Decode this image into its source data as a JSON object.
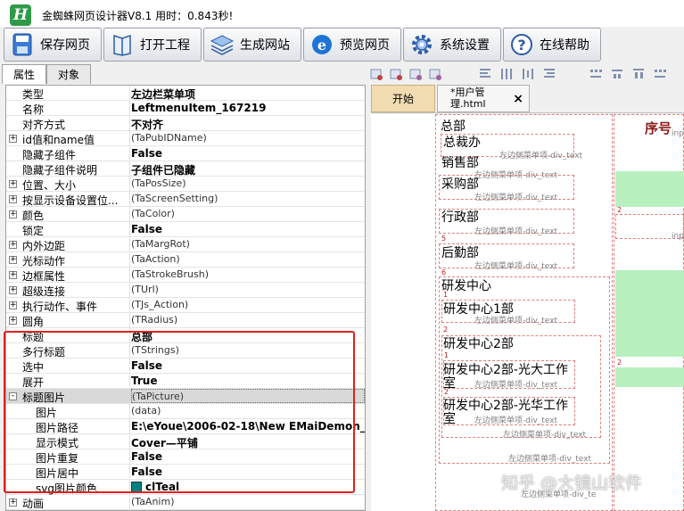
{
  "window": {
    "logo_letter": "H",
    "title": "金蜘蛛网页设计器V8.1 用时：0.843秒!"
  },
  "toolbar": [
    {
      "label": "保存网页",
      "icon": "save-icon"
    },
    {
      "label": "打开工程",
      "icon": "open-book-icon"
    },
    {
      "label": "生成网站",
      "icon": "layers-icon"
    },
    {
      "label": "预览网页",
      "icon": "ie-browser-icon"
    },
    {
      "label": "系统设置",
      "icon": "gear-icon"
    },
    {
      "label": "在线帮助",
      "icon": "help-icon"
    }
  ],
  "panel_tabs": {
    "properties": "属性",
    "objects": "对象"
  },
  "properties": [
    {
      "name": "类型",
      "value": "左边栏菜单项",
      "bold": true
    },
    {
      "name": "名称",
      "value": "LeftmenuItem_167219",
      "bold": true
    },
    {
      "name": "对齐方式",
      "value": "不对齐",
      "bold": true
    },
    {
      "name": "id值和name值",
      "value": "(TaPubIDName)",
      "expand": "+"
    },
    {
      "name": "隐藏子组件",
      "value": "False",
      "bold": true
    },
    {
      "name": "隐藏子组件说明",
      "value": "子组件已隐藏",
      "bold": true
    },
    {
      "name": "位置、大小",
      "value": "(TaPosSize)",
      "expand": "+"
    },
    {
      "name": "按显示设备设置位...",
      "value": "(TaScreenSetting)",
      "expand": "+"
    },
    {
      "name": "颜色",
      "value": "(TaColor)",
      "expand": "+"
    },
    {
      "name": "锁定",
      "value": "False",
      "bold": true
    },
    {
      "name": "内外边距",
      "value": "(TaMargRot)",
      "expand": "+"
    },
    {
      "name": "光标动作",
      "value": "(TaAction)",
      "expand": "+"
    },
    {
      "name": "边框属性",
      "value": "(TaStrokeBrush)",
      "expand": "+"
    },
    {
      "name": "超级连接",
      "value": "(TUrl)",
      "expand": "+"
    },
    {
      "name": "执行动作、事件",
      "value": "(TJs_Action)",
      "expand": "+"
    },
    {
      "name": "圆角",
      "value": "(TRadius)",
      "expand": "+"
    },
    {
      "name": "标题",
      "value": "总部",
      "bold": true
    },
    {
      "name": "多行标题",
      "value": "(TStrings)"
    },
    {
      "name": "选中",
      "value": "False",
      "bold": true
    },
    {
      "name": "展开",
      "value": "True",
      "bold": true
    },
    {
      "name": "标题图片",
      "value": "(TaPicture)",
      "expand": "-",
      "selected": true
    },
    {
      "name": "图片",
      "value": "(data)",
      "indent": true
    },
    {
      "name": "图片路径",
      "value": "E:\\eYoue\\2006-02-18\\New EMaiDemon_Chin...",
      "bold": true,
      "indent": true
    },
    {
      "name": "显示模式",
      "value": "Cover—平铺",
      "bold": true,
      "indent": true
    },
    {
      "name": "图片重复",
      "value": "False",
      "bold": true,
      "indent": true
    },
    {
      "name": "图片居中",
      "value": "False",
      "bold": true,
      "indent": true
    },
    {
      "name": "svg图片颜色",
      "value": "clTeal",
      "bold": true,
      "indent": true,
      "swatch": "#008080"
    },
    {
      "name": "动画",
      "value": "(TaAnim)",
      "expand": "+"
    }
  ],
  "doc_tabs": {
    "start": "开始",
    "page": "*用户管理.html",
    "close": "×"
  },
  "canvas": {
    "tag": "左边侧菜单项-div_text",
    "tag_short": "左边侧菜单项-div_te",
    "inp": "inp",
    "seq_header": "序号",
    "nums": [
      "1",
      "2",
      "5",
      "6",
      "1",
      "2",
      "1",
      "2"
    ],
    "menu": [
      "总部",
      "总裁办",
      "销售部",
      "采购部",
      "行政部",
      "后勤部",
      "研发中心",
      "研发中心1部",
      "研发中心2部",
      "研发中心2部-光大工作",
      "室",
      "研发中心2部-光华工作",
      "室"
    ]
  },
  "watermark": "知乎 @大镜山软件",
  "colors": {
    "accent_red": "#e02020",
    "green_fill": "#b8f0c0",
    "tab_start": "#f0dcb0",
    "header_red": "#8b1a1a"
  }
}
